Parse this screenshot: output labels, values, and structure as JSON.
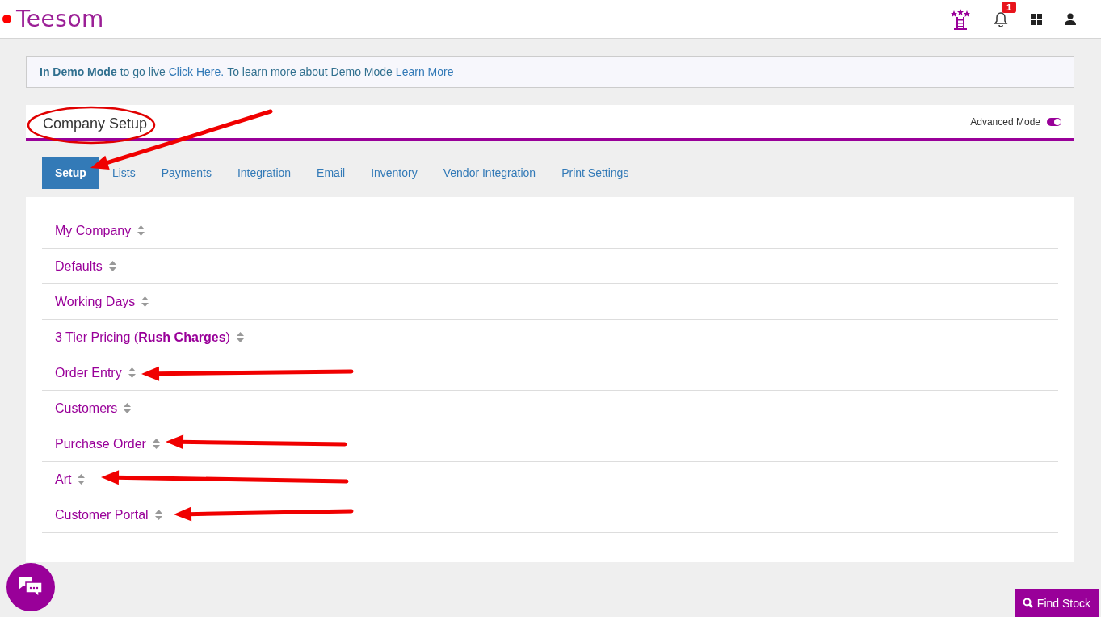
{
  "header": {
    "logo": "Teesom",
    "notification_count": "1"
  },
  "banner": {
    "lead": "In Demo Mode",
    "text_1": "to go live",
    "link_1": "Click Here.",
    "text_2": "To learn more about Demo Mode",
    "link_2": "Learn More"
  },
  "page": {
    "title": "Company Setup",
    "advanced_mode": {
      "label": "Advanced Mode",
      "on": true
    }
  },
  "tabs": [
    {
      "label": "Setup",
      "selected": true
    },
    {
      "label": "Lists",
      "selected": false
    },
    {
      "label": "Payments",
      "selected": false
    },
    {
      "label": "Integration",
      "selected": false
    },
    {
      "label": "Email",
      "selected": false
    },
    {
      "label": "Inventory",
      "selected": false
    },
    {
      "label": "Vendor Integration",
      "selected": false
    },
    {
      "label": "Print Settings",
      "selected": false
    }
  ],
  "sections": [
    {
      "label": "My Company"
    },
    {
      "label": "Defaults"
    },
    {
      "label": "Working Days"
    },
    {
      "label": "3 Tier Pricing (**Rush Charges**)"
    },
    {
      "label": "Order Entry"
    },
    {
      "label": "Customers"
    },
    {
      "label": "Purchase Order"
    },
    {
      "label": "Art"
    },
    {
      "label": "Customer Portal"
    }
  ],
  "annotations": [
    {
      "kind": "ellipse"
    },
    {
      "kind": "arrow"
    },
    {
      "kind": "arrow"
    },
    {
      "kind": "arrow"
    },
    {
      "kind": "arrow"
    },
    {
      "kind": "arrow"
    }
  ],
  "find_stock": {
    "label": "Find Stock"
  }
}
